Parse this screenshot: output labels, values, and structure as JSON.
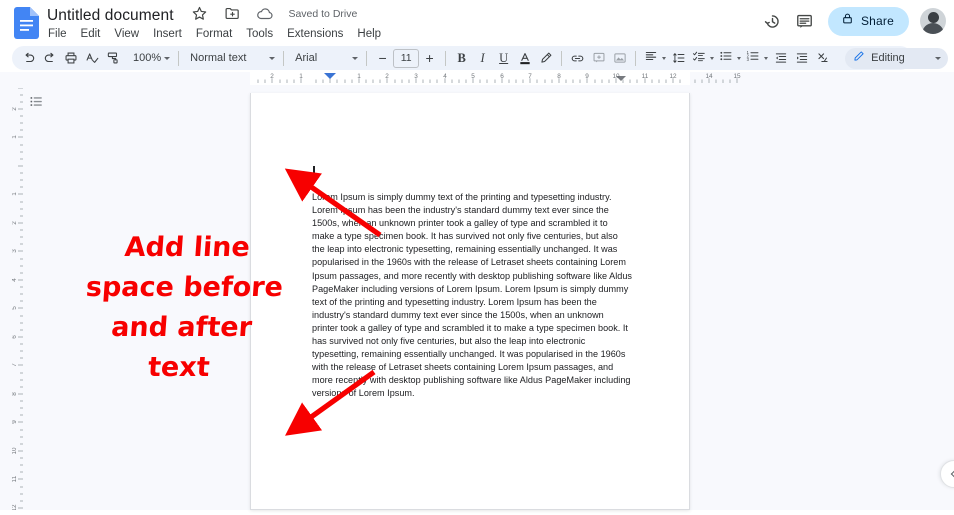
{
  "app": {
    "name": "Google Docs",
    "logo_icon": "docs-file-icon"
  },
  "header": {
    "doc_title": "Untitled document",
    "star_icon": "star-outline-icon",
    "move_icon": "move-to-folder-icon",
    "cloud_icon": "cloud-saved-icon",
    "save_status": "Saved to Drive",
    "menu_items": [
      {
        "label": "File"
      },
      {
        "label": "Edit"
      },
      {
        "label": "View"
      },
      {
        "label": "Insert"
      },
      {
        "label": "Format"
      },
      {
        "label": "Tools"
      },
      {
        "label": "Extensions"
      },
      {
        "label": "Help"
      }
    ],
    "history_icon": "version-history-icon",
    "comment_icon": "open-comment-history-icon",
    "share": {
      "label": "Share",
      "lock_icon": "lock-icon",
      "bg_color": "#c2e7ff",
      "text_color": "#001d35"
    },
    "avatar": "user-avatar"
  },
  "toolbar": {
    "undo": "undo-icon",
    "redo": "redo-icon",
    "print": "print-icon",
    "spellcheck": "spellcheck-icon",
    "paint_format": "paint-format-icon",
    "zoom_value": "100%",
    "style_value": "Normal text",
    "font_value": "Arial",
    "font_size_decrease": "−",
    "font_size_value": "11",
    "font_size_increase": "+",
    "bold": "B",
    "italic": "I",
    "underline": "U",
    "text_color": "text-color-icon",
    "highlight_color": "highlight-color-icon",
    "insert_link": "insert-link-icon",
    "add_comment": "add-comment-icon",
    "insert_image": "insert-image-icon",
    "align": "align-left-icon",
    "line_spacing": "line-spacing-icon",
    "checklist": "checklist-icon",
    "bulleted_list": "bulleted-list-icon",
    "numbered_list": "numbered-list-icon",
    "decrease_indent": "decrease-indent-icon",
    "increase_indent": "increase-indent-icon",
    "clear_formatting": "clear-formatting-icon",
    "mode": {
      "label": "Editing",
      "pencil_icon": "pencil-icon"
    },
    "collapse_toolbar": "chevron-up-icon"
  },
  "workspace": {
    "outline_icon": "show-document-outline-icon",
    "hruler_labels": [
      "2",
      "1",
      "1",
      "2",
      "3",
      "4",
      "5",
      "6",
      "7",
      "8",
      "9",
      "10",
      "11",
      "12",
      "13",
      "14",
      "15"
    ],
    "vruler_labels": [
      "2",
      "1",
      "1",
      "2",
      "3",
      "4",
      "5",
      "6",
      "7",
      "8",
      "9",
      "10",
      "11",
      "12",
      "13",
      "14"
    ],
    "collapse_side_panel": "chevron-left-icon"
  },
  "document": {
    "cursor": "text-caret",
    "body": "Lorem Ipsum is simply dummy text of the printing and typesetting industry. Lorem Ipsum has been the industry's standard dummy text ever since the 1500s, when an unknown printer took a galley of type and scrambled it to make a type specimen book. It has survived not only five centuries, but also the leap into electronic typesetting, remaining essentially unchanged. It was popularised in the 1960s with the release of Letraset sheets containing Lorem Ipsum passages, and more recently with desktop publishing software like Aldus PageMaker including versions of Lorem Ipsum. Lorem Ipsum is simply dummy text of the printing and typesetting industry. Lorem Ipsum has been the industry's standard dummy text ever since the 1500s, when an unknown printer took a galley of type and scrambled it to make a type specimen book. It has survived not only five centuries, but also the leap into electronic typesetting, remaining essentially unchanged. It was popularised in the 1960s with the release of Letraset sheets containing Lorem Ipsum passages, and more recently with desktop publishing software like Aldus PageMaker including versions of Lorem Ipsum."
  },
  "annotation": {
    "color": "#f70000",
    "text_line1": "Add line",
    "text_line2": "space before",
    "text_line3": "and after",
    "text_line4": "text",
    "arrow_top": "annotation-arrow-to-cursor",
    "arrow_bottom": "annotation-arrow-to-paragraph-end"
  }
}
